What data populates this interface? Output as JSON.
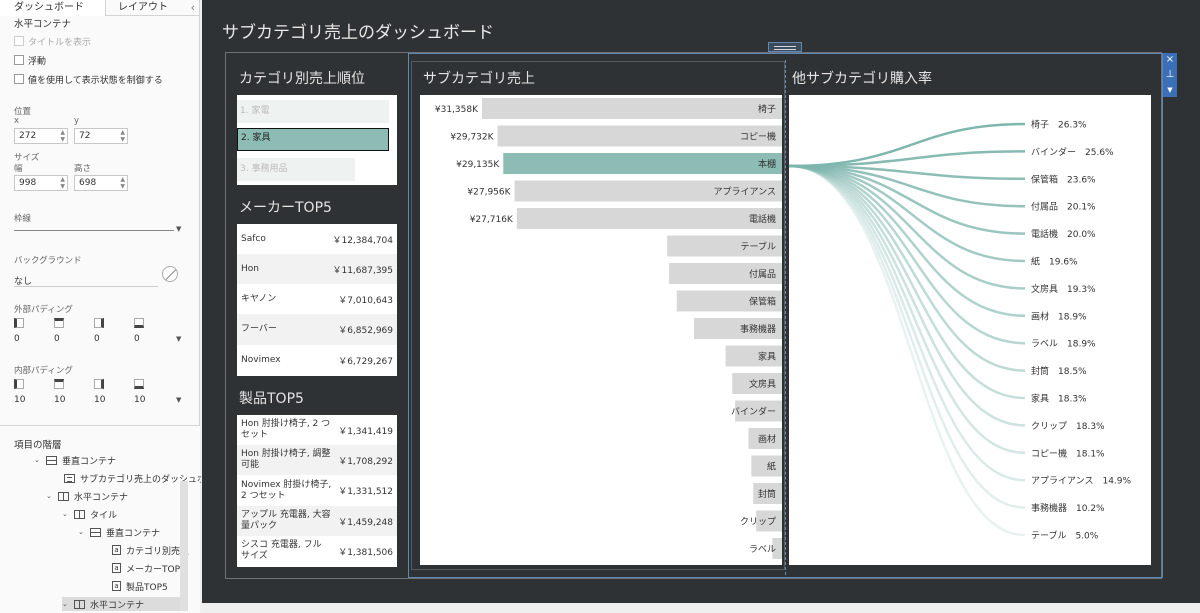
{
  "panel": {
    "tabs": [
      "ダッシュボード",
      "レイアウト"
    ],
    "container_name": "水平コンテナ",
    "show_title_label": "タイトルを表示",
    "float_label": "浮動",
    "visibility_label": "値を使用して表示状態を制御する",
    "position_label": "位置",
    "x_label": "x",
    "y_label": "y",
    "x_value": "272",
    "y_value": "72",
    "size_label": "サイズ",
    "width_label": "幅",
    "height_label": "高さ",
    "width_value": "998",
    "height_value": "698",
    "border_label": "枠線",
    "background_label": "バックグラウンド",
    "background_value": "なし",
    "outer_padding_label": "外部パディング",
    "outer_padding": [
      "0",
      "0",
      "0",
      "0"
    ],
    "inner_padding_label": "内部パディング",
    "inner_padding": [
      "10",
      "10",
      "10",
      "10"
    ]
  },
  "hierarchy": {
    "title": "項目の階層",
    "items": [
      {
        "label": "垂直コンテナ",
        "icon": "vertical-container-icon"
      },
      {
        "label": "サブカテゴリ売上のダッシュボ",
        "icon": "title-icon"
      },
      {
        "label": "水平コンテナ",
        "icon": "horizontal-container-icon"
      },
      {
        "label": "タイル",
        "icon": "tiled-icon"
      },
      {
        "label": "垂直コンテナ",
        "icon": "vertical-container-icon"
      },
      {
        "label": "カテゴリ別売上",
        "icon": "sheet-icon"
      },
      {
        "label": "メーカーTOP5",
        "icon": "sheet-icon"
      },
      {
        "label": "製品TOP5",
        "icon": "sheet-icon"
      },
      {
        "label": "水平コンテナ",
        "icon": "horizontal-container-icon"
      }
    ]
  },
  "dashboard": {
    "title": "サブカテゴリ売上のダッシュボード"
  },
  "category": {
    "title": "カテゴリ別売上順位",
    "items": [
      "1. 家電",
      "2. 家具",
      "3. 事務用品"
    ],
    "selected_index": 1
  },
  "makers": {
    "title": "メーカーTOP5",
    "rows": [
      {
        "name": "Safco",
        "value": "￥12,384,704"
      },
      {
        "name": "Hon",
        "value": "￥11,687,395"
      },
      {
        "name": "キヤノン",
        "value": "￥7,010,643"
      },
      {
        "name": "フーバー",
        "value": "￥6,852,969"
      },
      {
        "name": "Novimex",
        "value": "￥6,729,267"
      }
    ]
  },
  "products": {
    "title": "製品TOP5",
    "rows": [
      {
        "name": "Hon 肘掛け椅子, 2 つセット",
        "value": "￥1,341,419"
      },
      {
        "name": "Hon 肘掛け椅子, 調整可能",
        "value": "￥1,708,292"
      },
      {
        "name": "Novimex 肘掛け椅子, 2 つセット",
        "value": "￥1,331,512"
      },
      {
        "name": "アップル 充電器, 大容量パック",
        "value": "￥1,459,248"
      },
      {
        "name": "シスコ 充電器, フル サイズ",
        "value": "￥1,381,506"
      }
    ]
  },
  "subcat_chart": {
    "title": "サブカテゴリ売上",
    "chart_data": {
      "type": "bar",
      "orientation": "horizontal",
      "categories": [
        "椅子",
        "コピー機",
        "本棚",
        "アプライアンス",
        "電話機",
        "テーブル",
        "付属品",
        "保管箱",
        "事務機器",
        "家具",
        "文房具",
        "バインダー",
        "画材",
        "紙",
        "封筒",
        "クリップ",
        "ラベル"
      ],
      "values": [
        31358,
        29732,
        29135,
        27956,
        27716,
        12000,
        11800,
        11000,
        9200,
        5900,
        5200,
        4900,
        3500,
        3200,
        3000,
        2700,
        1000
      ],
      "value_unit": "K",
      "value_labels": [
        "¥31,358K",
        "¥29,732K",
        "¥29,135K",
        "¥27,956K",
        "¥27,716K",
        "",
        "",
        "",
        "",
        "",
        "",
        "",
        "",
        "",
        "",
        "",
        ""
      ],
      "highlight_index": 2,
      "colors": {
        "bar": "#d7d7d7",
        "highlight": "#8cbcb4"
      }
    }
  },
  "sankey": {
    "title": "他サブカテゴリ購入率",
    "chart_data": {
      "type": "line",
      "source": "本棚",
      "targets": [
        {
          "name": "椅子",
          "rate": "26.3%"
        },
        {
          "name": "バインダー",
          "rate": "25.6%"
        },
        {
          "name": "保管箱",
          "rate": "23.6%"
        },
        {
          "name": "付属品",
          "rate": "20.1%"
        },
        {
          "name": "電話機",
          "rate": "20.0%"
        },
        {
          "name": "紙",
          "rate": "19.6%"
        },
        {
          "name": "文房具",
          "rate": "19.3%"
        },
        {
          "name": "画材",
          "rate": "18.9%"
        },
        {
          "name": "ラベル",
          "rate": "18.9%"
        },
        {
          "name": "封筒",
          "rate": "18.5%"
        },
        {
          "name": "家具",
          "rate": "18.3%"
        },
        {
          "name": "クリップ",
          "rate": "18.3%"
        },
        {
          "name": "コピー機",
          "rate": "18.1%"
        },
        {
          "name": "アプライアンス",
          "rate": "14.9%"
        },
        {
          "name": "事務機器",
          "rate": "10.2%"
        },
        {
          "name": "テーブル",
          "rate": "5.0%"
        }
      ],
      "colors": {
        "flow": "#7fb6ad"
      }
    }
  },
  "toolbar": {
    "close_icon": "×",
    "pin_icon": "⊥",
    "menu_icon": "▼"
  },
  "colors": {
    "dashboard_bg": "#2f3235",
    "selection": "#5f87b6",
    "accent": "#8cbcb4"
  }
}
